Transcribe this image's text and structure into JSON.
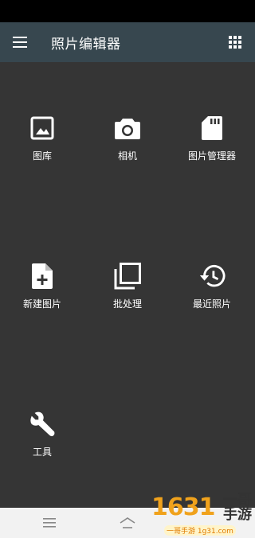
{
  "app_bar": {
    "title": "照片编辑器",
    "menu_icon": "hamburger-menu-icon",
    "apps_icon": "grid-apps-icon"
  },
  "tiles": [
    {
      "label": "图库",
      "icon": "gallery-image-icon"
    },
    {
      "label": "相机",
      "icon": "camera-icon"
    },
    {
      "label": "图片管理器",
      "icon": "sd-card-icon"
    },
    {
      "label": "新建图片",
      "icon": "new-file-icon"
    },
    {
      "label": "批处理",
      "icon": "batch-copy-icon"
    },
    {
      "label": "最近照片",
      "icon": "history-icon"
    },
    {
      "label": "工具",
      "icon": "wrench-icon"
    }
  ],
  "nav_bar": {
    "menu_icon": "nav-menu-icon",
    "home_icon": "nav-home-icon"
  },
  "watermark": {
    "number": "1631",
    "title_line1": "一哥",
    "title_line2": "手游",
    "url": "一哥手游 1g31.com"
  },
  "colors": {
    "background": "#353535",
    "app_bar": "#37474f",
    "status_bar": "#000000",
    "nav_bar": "#f2f2f2",
    "icon": "#ffffff"
  }
}
